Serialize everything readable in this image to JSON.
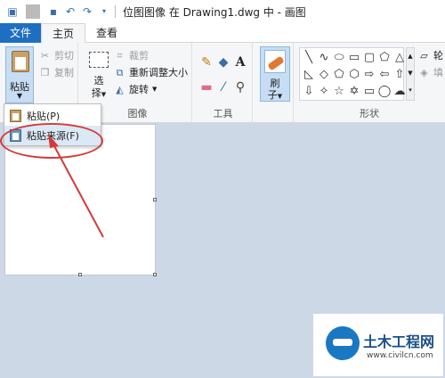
{
  "window": {
    "title": "位图图像 在 Drawing1.dwg 中 - 画图"
  },
  "quick_access": {
    "icons": [
      "app-icon",
      "save-icon",
      "undo-icon",
      "redo-icon",
      "customize-icon"
    ]
  },
  "tabs": {
    "file": "文件",
    "home": "主页",
    "view": "查看"
  },
  "ribbon": {
    "clipboard": {
      "paste": "粘贴",
      "cut": "剪切",
      "copy": "复制"
    },
    "image": {
      "label": "图像",
      "select_line1": "选",
      "select_line2": "择",
      "crop": "裁剪",
      "resize": "重新调整大小",
      "rotate": "旋转"
    },
    "tools": {
      "label": "工具",
      "text_tool": "A"
    },
    "brushes": {
      "line1": "刷",
      "line2": "子"
    },
    "shapes": {
      "label": "形状",
      "outline": "轮",
      "fill": "填"
    }
  },
  "paste_menu": {
    "items": [
      "粘贴(P)",
      "粘贴来源(F)"
    ]
  },
  "watermark": {
    "title": "土木工程网",
    "url": "www.civilcn.com"
  },
  "colors": {
    "file_tab": "#1e6fc2",
    "annotation": "#d33a3a",
    "workspace": "#cdd8e6"
  }
}
